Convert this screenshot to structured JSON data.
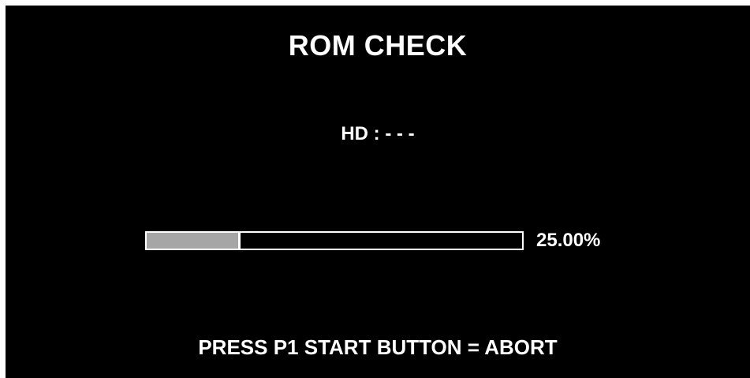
{
  "screen": {
    "title": "ROM CHECK",
    "hd_status": "HD : - - -",
    "progress": {
      "fraction": 0.25,
      "percent_label": "25.00%"
    },
    "abort_hint": "PRESS P1 START BUTTON = ABORT"
  },
  "colors": {
    "background": "#000000",
    "text": "#ffffff",
    "progress_fill": "#a6a6a6"
  }
}
